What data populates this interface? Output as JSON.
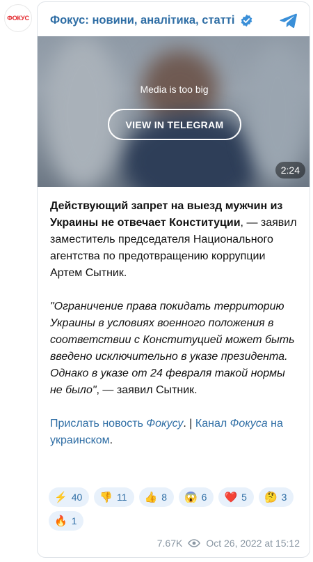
{
  "avatar": {
    "text": "ФОКУС"
  },
  "header": {
    "title": "Фокус: новини, аналітика, статті"
  },
  "media": {
    "note": "Media is too big",
    "button_label": "VIEW IN TELEGRAM",
    "duration": "2:24"
  },
  "post": {
    "lead_bold": "Действующий запрет на выезд мужчин из Украины не отвечает Конституции",
    "lead_rest": ", — заявил заместитель председателя Национального агентства по предотвращению коррупции Артем Сытник.",
    "quote_italic": "\"Ограничение права покидать территорию Украины в условиях военного положения в соответствии с Конституцией может быть введено исключительно в указе президента. Однако в указе от 24 февраля такой нормы не было\"",
    "quote_rest": ", — заявил Сытник.",
    "link1_text": "Прислать новость ",
    "link1_italic": "Фокусу",
    "separator": ". | ",
    "link2_text": "Канал ",
    "link2_italic": "Фокуса",
    "link2_suffix": " на украинском",
    "tail": "."
  },
  "reactions": [
    {
      "emoji": "⚡",
      "count": "40",
      "name": "reaction-lightning"
    },
    {
      "emoji": "👎",
      "count": "11",
      "name": "reaction-thumbs-down"
    },
    {
      "emoji": "👍",
      "count": "8",
      "name": "reaction-thumbs-up"
    },
    {
      "emoji": "😱",
      "count": "6",
      "name": "reaction-scream"
    },
    {
      "emoji": "❤️",
      "count": "5",
      "name": "reaction-heart"
    },
    {
      "emoji": "🤔",
      "count": "3",
      "name": "reaction-thinking"
    },
    {
      "emoji": "🔥",
      "count": "1",
      "name": "reaction-fire"
    }
  ],
  "footer": {
    "views": "7.67K",
    "date": "Oct 26, 2022 at 15:12"
  },
  "colors": {
    "accent": "#2f6ea5",
    "brand_red": "#e3262b",
    "reaction_bg": "#e8f1fb",
    "muted": "#8a97a3"
  }
}
